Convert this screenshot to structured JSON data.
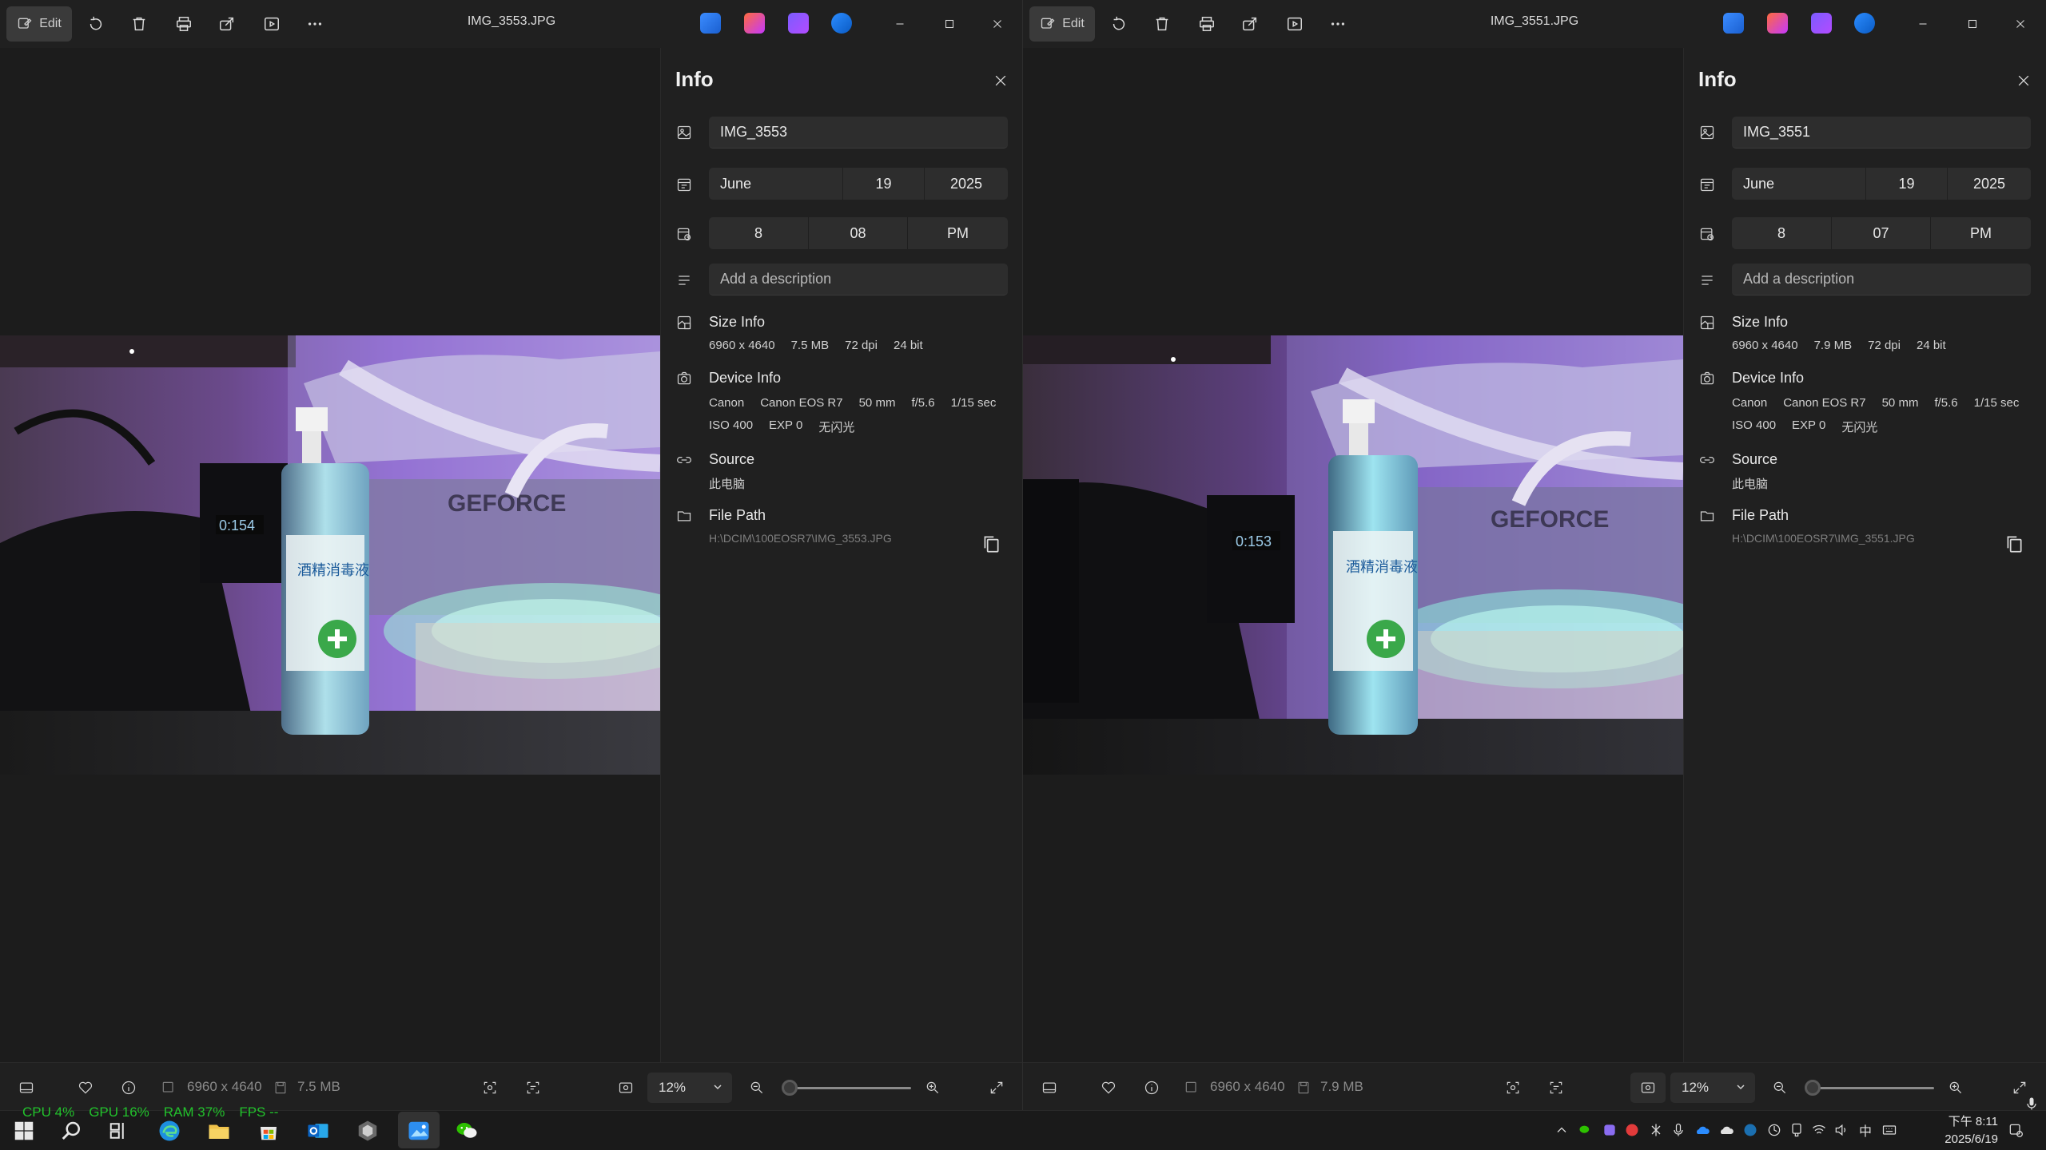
{
  "windows": [
    {
      "edit_label": "Edit",
      "title": "IMG_3553.JPG",
      "info": {
        "heading": "Info",
        "file_name": "IMG_3553",
        "date": {
          "month": "June",
          "day": "19",
          "year": "2025"
        },
        "time": {
          "hour": "8",
          "minute": "08",
          "ampm": "PM"
        },
        "description_placeholder": "Add a description",
        "size_info": {
          "title": "Size Info",
          "dimensions": "6960 x 4640",
          "filesize": "7.5 MB",
          "dpi": "72 dpi",
          "bitdepth": "24 bit"
        },
        "device_info": {
          "title": "Device Info",
          "make": "Canon",
          "model": "Canon EOS R7",
          "focal": "50 mm",
          "aperture": "f/5.6",
          "shutter": "1/15 sec",
          "iso": "ISO 400",
          "exp": "EXP 0",
          "flash": "无闪光"
        },
        "source": {
          "title": "Source",
          "value": "此电脑"
        },
        "file_path": {
          "title": "File Path",
          "value": "H:\\DCIM\\100EOSR7\\IMG_3553.JPG"
        }
      },
      "bottom": {
        "dimensions": "6960 x 4640",
        "filesize": "7.5 MB",
        "zoom": "12%"
      }
    },
    {
      "edit_label": "Edit",
      "title": "IMG_3551.JPG",
      "info": {
        "heading": "Info",
        "file_name": "IMG_3551",
        "date": {
          "month": "June",
          "day": "19",
          "year": "2025"
        },
        "time": {
          "hour": "8",
          "minute": "07",
          "ampm": "PM"
        },
        "description_placeholder": "Add a description",
        "size_info": {
          "title": "Size Info",
          "dimensions": "6960 x 4640",
          "filesize": "7.9 MB",
          "dpi": "72 dpi",
          "bitdepth": "24 bit"
        },
        "device_info": {
          "title": "Device Info",
          "make": "Canon",
          "model": "Canon EOS R7",
          "focal": "50 mm",
          "aperture": "f/5.6",
          "shutter": "1/15 sec",
          "iso": "ISO 400",
          "exp": "EXP 0",
          "flash": "无闪光"
        },
        "source": {
          "title": "Source",
          "value": "此电脑"
        },
        "file_path": {
          "title": "File Path",
          "value": "H:\\DCIM\\100EOSR7\\IMG_3551.JPG"
        }
      },
      "bottom": {
        "dimensions": "6960 x 4640",
        "filesize": "7.9 MB",
        "zoom": "12%"
      }
    }
  ],
  "perf": {
    "cpu": "CPU   4%",
    "gpu": "GPU  16%",
    "ram": "RAM  37%",
    "fps": "FPS   --"
  },
  "tray": {
    "ime": "中",
    "time": "下午 8:11",
    "date": "2025/6/19"
  },
  "colors": {
    "accent": "#0078d4",
    "perf_green": "#22c22c"
  }
}
